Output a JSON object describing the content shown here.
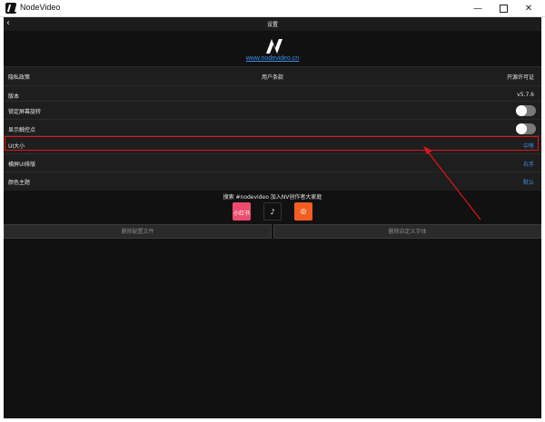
{
  "window": {
    "title": "NodeVideo",
    "minimize": "—",
    "maximize": "",
    "close": "✕"
  },
  "header": {
    "back": "‹",
    "title": "设置"
  },
  "site_link": "www.nodevideo.cn",
  "links_row": {
    "privacy": "隐私政策",
    "terms": "用户条款",
    "license": "开源许可证"
  },
  "rows": {
    "version": {
      "label": "版本",
      "value": "v5.7.6"
    },
    "lock_rotation": {
      "label": "锁定屏幕旋转",
      "on": false
    },
    "show_touch": {
      "label": "显示触控点",
      "on": false
    },
    "ui_size": {
      "label": "UI大小",
      "value": "中等"
    },
    "landscape": {
      "label": "横屏UI排版",
      "value": "右手"
    },
    "theme": {
      "label": "颜色主题",
      "value": "默认"
    }
  },
  "share_text": "搜索 #nodevideo 加入NV创作者大家庭",
  "social": {
    "xhs": "小红书",
    "tiktok": "♪",
    "kuaishou": "◎"
  },
  "buttons": {
    "delete_config": "删除配置文件",
    "delete_fonts": "删除自定义字体"
  },
  "colors": {
    "accent": "#3b8eea",
    "highlight": "#e0151b",
    "background": "#111111"
  }
}
